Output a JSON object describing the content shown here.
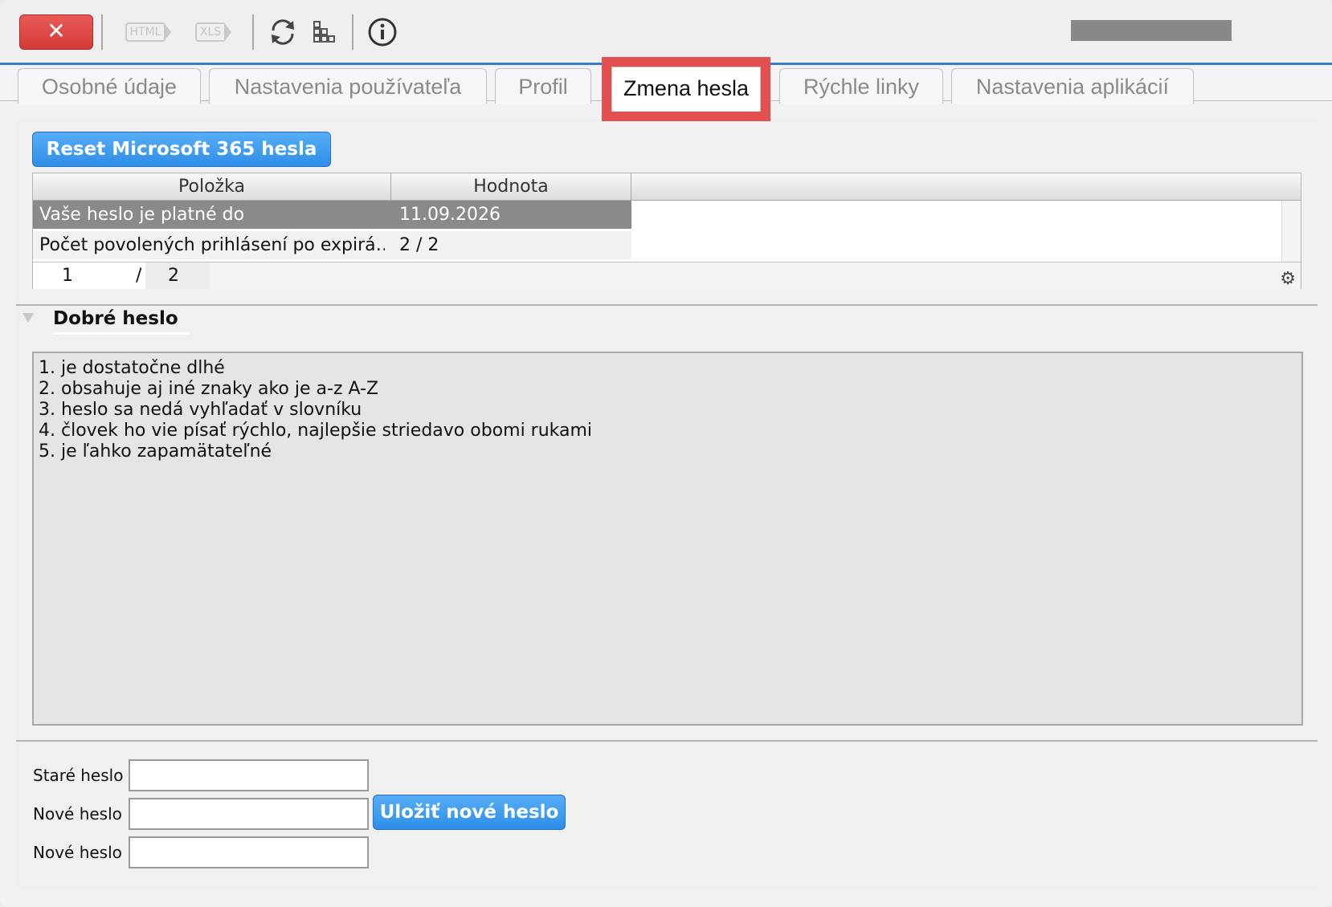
{
  "toolbar": {
    "close_glyph": "✕",
    "html_label": "HTML",
    "xls_label": "XLS",
    "icons": [
      "close-icon",
      "html-export-icon",
      "xls-export-icon",
      "refresh-icon",
      "org-chart-icon",
      "info-icon"
    ]
  },
  "tabs": [
    {
      "label": "Osobné údaje",
      "active": false
    },
    {
      "label": "Nastavenia používateľa",
      "active": false
    },
    {
      "label": "Profil",
      "active": false
    },
    {
      "label": "Zmena hesla",
      "active": true
    },
    {
      "label": "Rýchle linky",
      "active": false
    },
    {
      "label": "Nastavenia aplikácií",
      "active": false
    }
  ],
  "reset_button": "Reset Microsoft 365 hesla",
  "grid": {
    "columns": [
      "Položka",
      "Hodnota"
    ],
    "rows": [
      {
        "item": "Vaše heslo je platné do",
        "value": "11.09.2026",
        "selected": true
      },
      {
        "item": "Počet povolených prihlásení po expirá…",
        "value": "2 / 2",
        "selected": false
      }
    ],
    "pager": {
      "current": "1",
      "separator": "/",
      "total": "2"
    },
    "settings_icon": "gear-icon"
  },
  "good_password": {
    "title": "Dobré heslo",
    "lines": [
      "1. je dostatočne dlhé",
      "2. obsahuje aj iné znaky ako je a-z A-Z",
      "3. heslo sa nedá vyhľadať v slovníku",
      "4. človek ho vie písať rýchlo, najlepšie striedavo obomi rukami",
      "5. je ľahko zapamätateľné"
    ]
  },
  "form": {
    "old_password_label": "Staré heslo",
    "new_password_label": "Nové heslo",
    "confirm_password_label": "Nové heslo",
    "old_password_value": "",
    "new_password_value": "",
    "confirm_password_value": "",
    "save_button": "Uložiť nové heslo"
  },
  "colors": {
    "accent_blue": "#2e8ee8",
    "close_red": "#d43a37",
    "highlight_red": "#e45050",
    "selected_row": "#8a8a8a"
  }
}
